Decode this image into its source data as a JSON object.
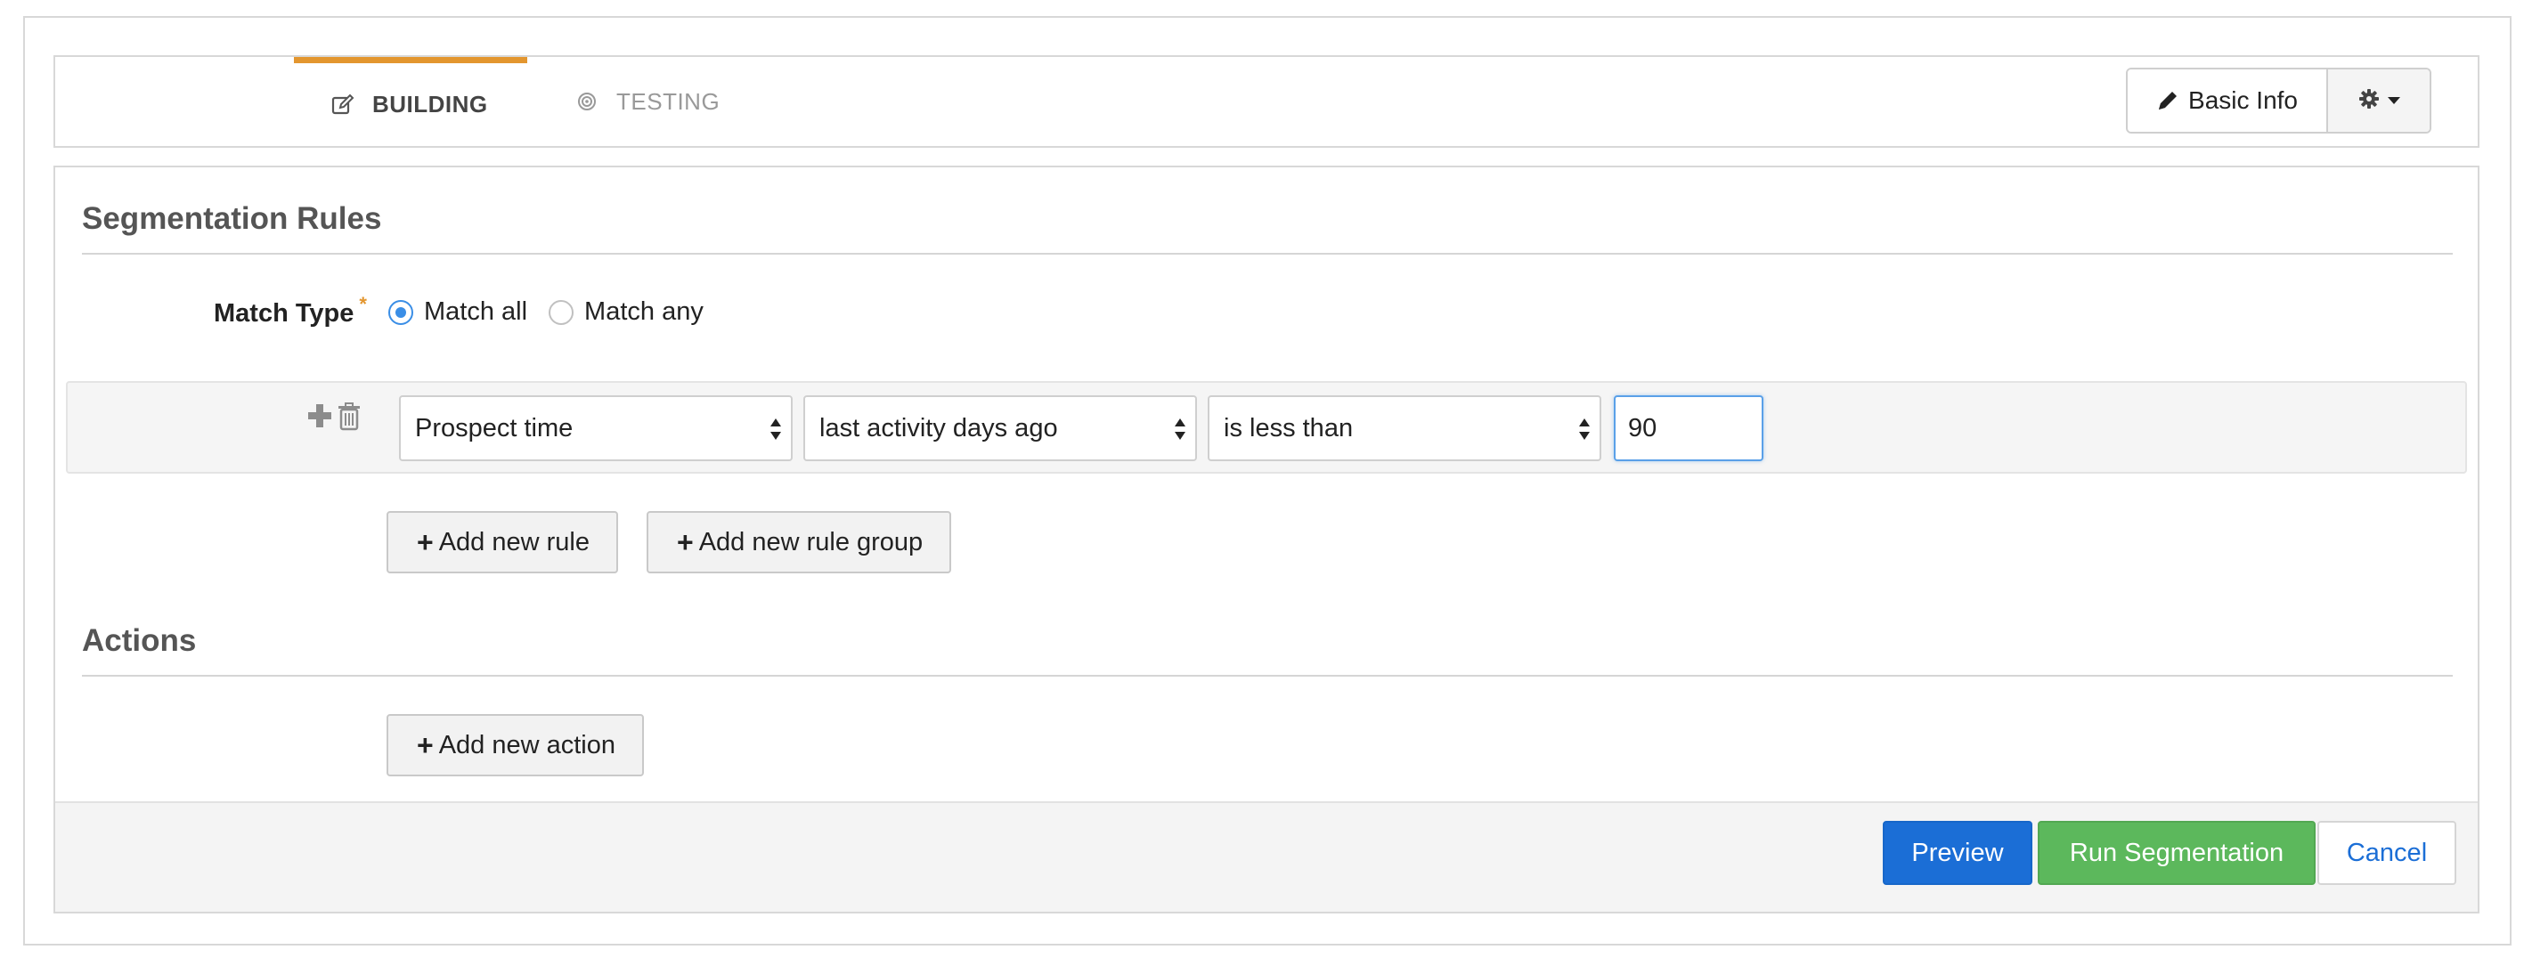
{
  "tabs": [
    {
      "label": "BUILDING",
      "icon": "edit-icon",
      "active": true
    },
    {
      "label": "TESTING",
      "icon": "target-icon",
      "active": false
    }
  ],
  "header": {
    "basic_info_label": "Basic Info",
    "settings_icon": "gear-icon"
  },
  "segmentation": {
    "title": "Segmentation Rules",
    "match_type_label": "Match Type",
    "required_mark": "*",
    "options": [
      "Match all",
      "Match any"
    ],
    "selected_option": "Match all"
  },
  "rule": {
    "field": "Prospect time",
    "criteria": "last activity days ago",
    "operator": "is less than",
    "value": "90"
  },
  "buttons": {
    "add_rule": "Add new rule",
    "add_rule_group": "Add new rule group",
    "add_action": "Add new action",
    "preview": "Preview",
    "run": "Run Segmentation",
    "cancel": "Cancel"
  },
  "actions": {
    "title": "Actions"
  },
  "colors": {
    "accent_tab": "#e3962f",
    "primary": "#1b6ed6",
    "success": "#5cb85c",
    "radio_checked": "#3a8ee6"
  }
}
